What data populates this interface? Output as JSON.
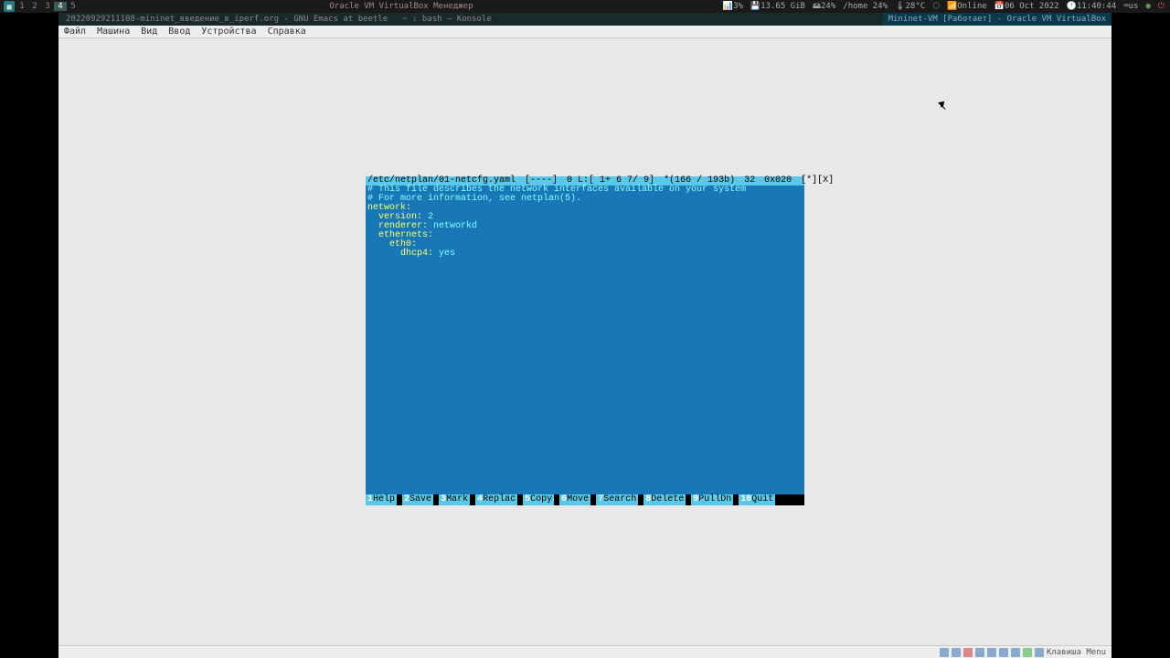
{
  "taskbar": {
    "workspaces": [
      "1",
      "2",
      "3",
      "4",
      "5"
    ],
    "active_ws": "4",
    "center_text": "Oracle VM VirtualBox Менеджер",
    "cpu": "3%",
    "mem": "13.65 GiB",
    "disk": "24%",
    "home": "/home 24%",
    "temp": "28°C",
    "net": "Online",
    "date": "06 Oct 2022",
    "time": "11:40:44",
    "layout": "us"
  },
  "title": {
    "left": "20220929211108-mininet_введение_в_iperf.org - GNU Emacs at beetle",
    "mid": "~ : bash — Konsole",
    "right": "Mininet-VM [Работает] - Oracle VM VirtualBox"
  },
  "vm_menu": [
    "Файл",
    "Машина",
    "Вид",
    "Ввод",
    "Устройства",
    "Справка"
  ],
  "term": {
    "status": {
      "path": "/etc/netplan/01-netcfg.yaml",
      "file_indicator": "[----]",
      "pos": "0 L:[  1+ 6   7/  9]",
      "bytes": "*(166 / 193b)",
      "col": "32",
      "hex": "0x020",
      "mode": "[*][X]"
    },
    "lines": [
      {
        "type": "comment",
        "text": "# This file describes the network interfaces available on your system"
      },
      {
        "type": "comment",
        "text": "# For more information, see netplan(5)."
      },
      {
        "type": "key",
        "text": "network:"
      },
      {
        "type": "kv",
        "indent": "  ",
        "k": "version:",
        "v": " 2"
      },
      {
        "type": "kv",
        "indent": "  ",
        "k": "renderer:",
        "v": " networkd"
      },
      {
        "type": "key",
        "indent": "  ",
        "text": "ethernets:"
      },
      {
        "type": "key",
        "indent": "    ",
        "text": "eth0:"
      },
      {
        "type": "kv",
        "indent": "      ",
        "k": "dhcp4:",
        "v": " yes"
      }
    ],
    "fnkeys": [
      {
        "n": "1",
        "l": "Help"
      },
      {
        "n": "2",
        "l": "Save"
      },
      {
        "n": "3",
        "l": "Mark"
      },
      {
        "n": "4",
        "l": "Replac"
      },
      {
        "n": "5",
        "l": "Copy"
      },
      {
        "n": "6",
        "l": "Move"
      },
      {
        "n": "7",
        "l": "Search"
      },
      {
        "n": "8",
        "l": "Delete"
      },
      {
        "n": "9",
        "l": "PullDn"
      },
      {
        "n": "10",
        "l": "Quit"
      }
    ]
  },
  "vm_status_hint": "Клавиша Menu"
}
